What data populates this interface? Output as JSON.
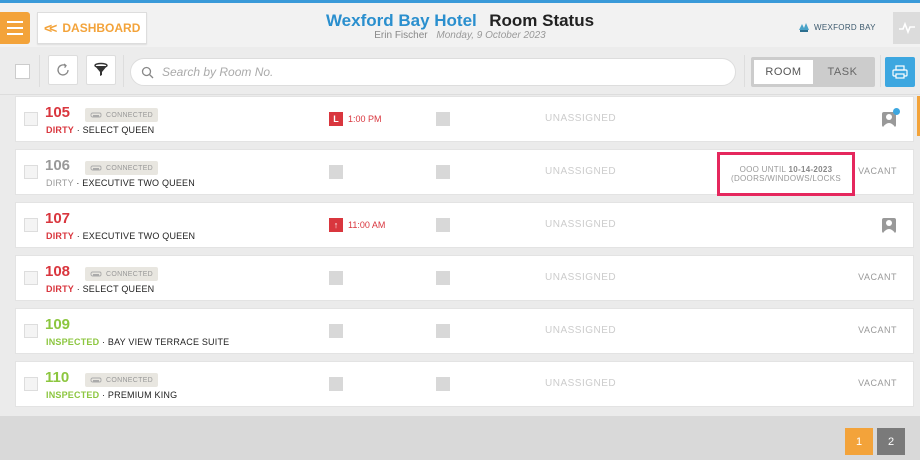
{
  "header": {
    "dashboard_label": "DASHBOARD",
    "hotel_name": "Wexford Bay Hotel",
    "page_title": "Room Status",
    "user_name": "Erin Fischer",
    "date": "Monday, 9 October 2023",
    "brand": "WEXFORD BAY"
  },
  "toolbar": {
    "search_placeholder": "Search by Room No.",
    "toggle": [
      {
        "label": "ROOM",
        "active": true
      },
      {
        "label": "TASK",
        "active": false
      }
    ]
  },
  "rooms": [
    {
      "number": "105",
      "status": "DIRTY",
      "type": "SELECT QUEEN",
      "connected": "CONNECTED",
      "time_tag": "L",
      "time": "1:00 PM",
      "assignment": "UNASSIGNED"
    },
    {
      "number": "106",
      "status": "DIRTY",
      "type": "EXECUTIVE TWO QUEEN",
      "connected": "CONNECTED",
      "assignment": "UNASSIGNED",
      "ooo_prefix": "OOO UNTIL ",
      "ooo_date": "10-14-2023",
      "ooo_reason": "(DOORS/WINDOWS/LOCKS",
      "occupancy": "VACANT"
    },
    {
      "number": "107",
      "status": "DIRTY",
      "type": "EXECUTIVE TWO QUEEN",
      "time_tag": "↑",
      "time": "11:00 AM",
      "assignment": "UNASSIGNED"
    },
    {
      "number": "108",
      "status": "DIRTY",
      "type": "SELECT QUEEN",
      "connected": "CONNECTED",
      "assignment": "UNASSIGNED",
      "occupancy": "VACANT"
    },
    {
      "number": "109",
      "status": "INSPECTED",
      "type": "BAY VIEW TERRACE SUITE",
      "assignment": "UNASSIGNED",
      "occupancy": "VACANT"
    },
    {
      "number": "110",
      "status": "INSPECTED",
      "type": "PREMIUM KING",
      "connected": "CONNECTED",
      "assignment": "UNASSIGNED",
      "occupancy": "VACANT"
    }
  ],
  "separator": " · ",
  "pagination": {
    "pages": [
      "1",
      "2"
    ],
    "current": "1"
  },
  "colors": {
    "dirty": "#d9363e",
    "inspected": "#8cc63f",
    "ooo_number": "#999999",
    "accent": "#f3a33a",
    "brand_blue": "#2a8fce",
    "highlight": "#e5275d"
  },
  "icons": [
    "menu-icon",
    "double-chevron-left-icon",
    "refresh-icon",
    "filter-icon",
    "search-icon",
    "print-icon",
    "activity-icon",
    "sofa-icon",
    "person-icon"
  ]
}
